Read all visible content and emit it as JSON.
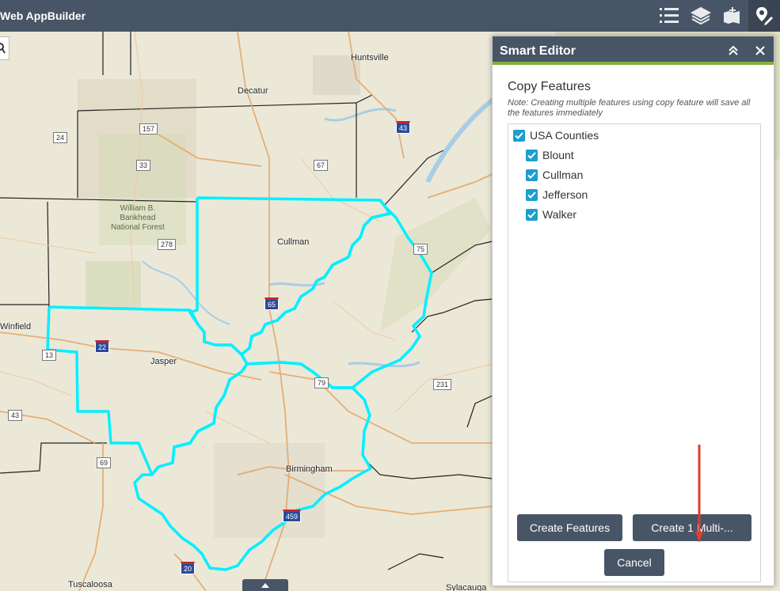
{
  "header": {
    "app_title": "Web AppBuilder",
    "buttons": [
      {
        "name": "legend-icon"
      },
      {
        "name": "layers-icon"
      },
      {
        "name": "basemap-icon"
      },
      {
        "name": "smart-editor-icon"
      }
    ]
  },
  "map": {
    "cities": [
      "Huntsville",
      "Decatur",
      "Cullman",
      "Winfield",
      "Jasper",
      "Birmingham",
      "Tuscaloosa",
      "Sylacauga"
    ],
    "park_label": "William B.\nBankhead\nNational Forest",
    "shields": [
      "157",
      "24",
      "33",
      "67",
      "43",
      "278",
      "65",
      "75",
      "22",
      "13",
      "79",
      "231",
      "43",
      "69",
      "459",
      "20"
    ]
  },
  "panel": {
    "title": "Smart Editor",
    "copy_title": "Copy Features",
    "copy_note": "Note: Creating multiple features using copy feature will save all the features immediately",
    "tree": {
      "root": "USA Counties",
      "children": [
        "Blount",
        "Cullman",
        "Jefferson",
        "Walker"
      ]
    },
    "buttons": {
      "create_features": "Create Features",
      "create_multi": "Create 1 Multi-...",
      "cancel": "Cancel"
    }
  },
  "colors": {
    "header": "#485566",
    "accent": "#7fb13a",
    "checkbox": "#1a9fcf",
    "highlight": "#00ffff",
    "arrow": "#e03c31"
  }
}
